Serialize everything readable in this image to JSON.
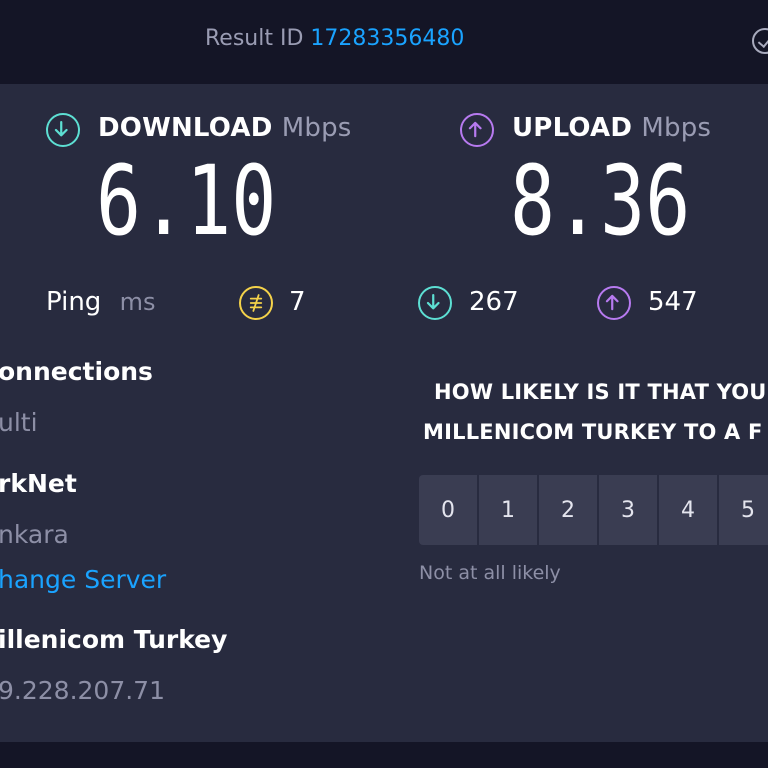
{
  "header": {
    "result_id_label": "Result ID",
    "result_id_value": "17283356480"
  },
  "download": {
    "label": "DOWNLOAD",
    "unit": "Mbps",
    "value": "6.10",
    "icon": "download-arrow-icon",
    "color": "#5ddfd3"
  },
  "upload": {
    "label": "UPLOAD",
    "unit": "Mbps",
    "value": "8.36",
    "icon": "upload-arrow-icon",
    "color": "#b77af0"
  },
  "ping": {
    "label": "Ping",
    "unit": "ms",
    "idle": "7",
    "download": "267",
    "upload": "547",
    "idle_color": "#f4d24a"
  },
  "connections": {
    "title": "onnections",
    "mode": "ulti"
  },
  "server": {
    "name": "rkNet",
    "location": "nkara",
    "change_link": "hange Server"
  },
  "provider": {
    "name": "illenicom Turkey",
    "ip": "9.228.207.71"
  },
  "survey": {
    "question_line1": "HOW LIKELY IS IT THAT YOU",
    "question_line2": "MILLENICOM TURKEY TO A F",
    "options": [
      "0",
      "1",
      "2",
      "3",
      "4",
      "5"
    ],
    "low_label": "Not at all likely"
  },
  "colors": {
    "background": "#141526",
    "panel": "#282b3f",
    "link": "#1aa3ff"
  }
}
